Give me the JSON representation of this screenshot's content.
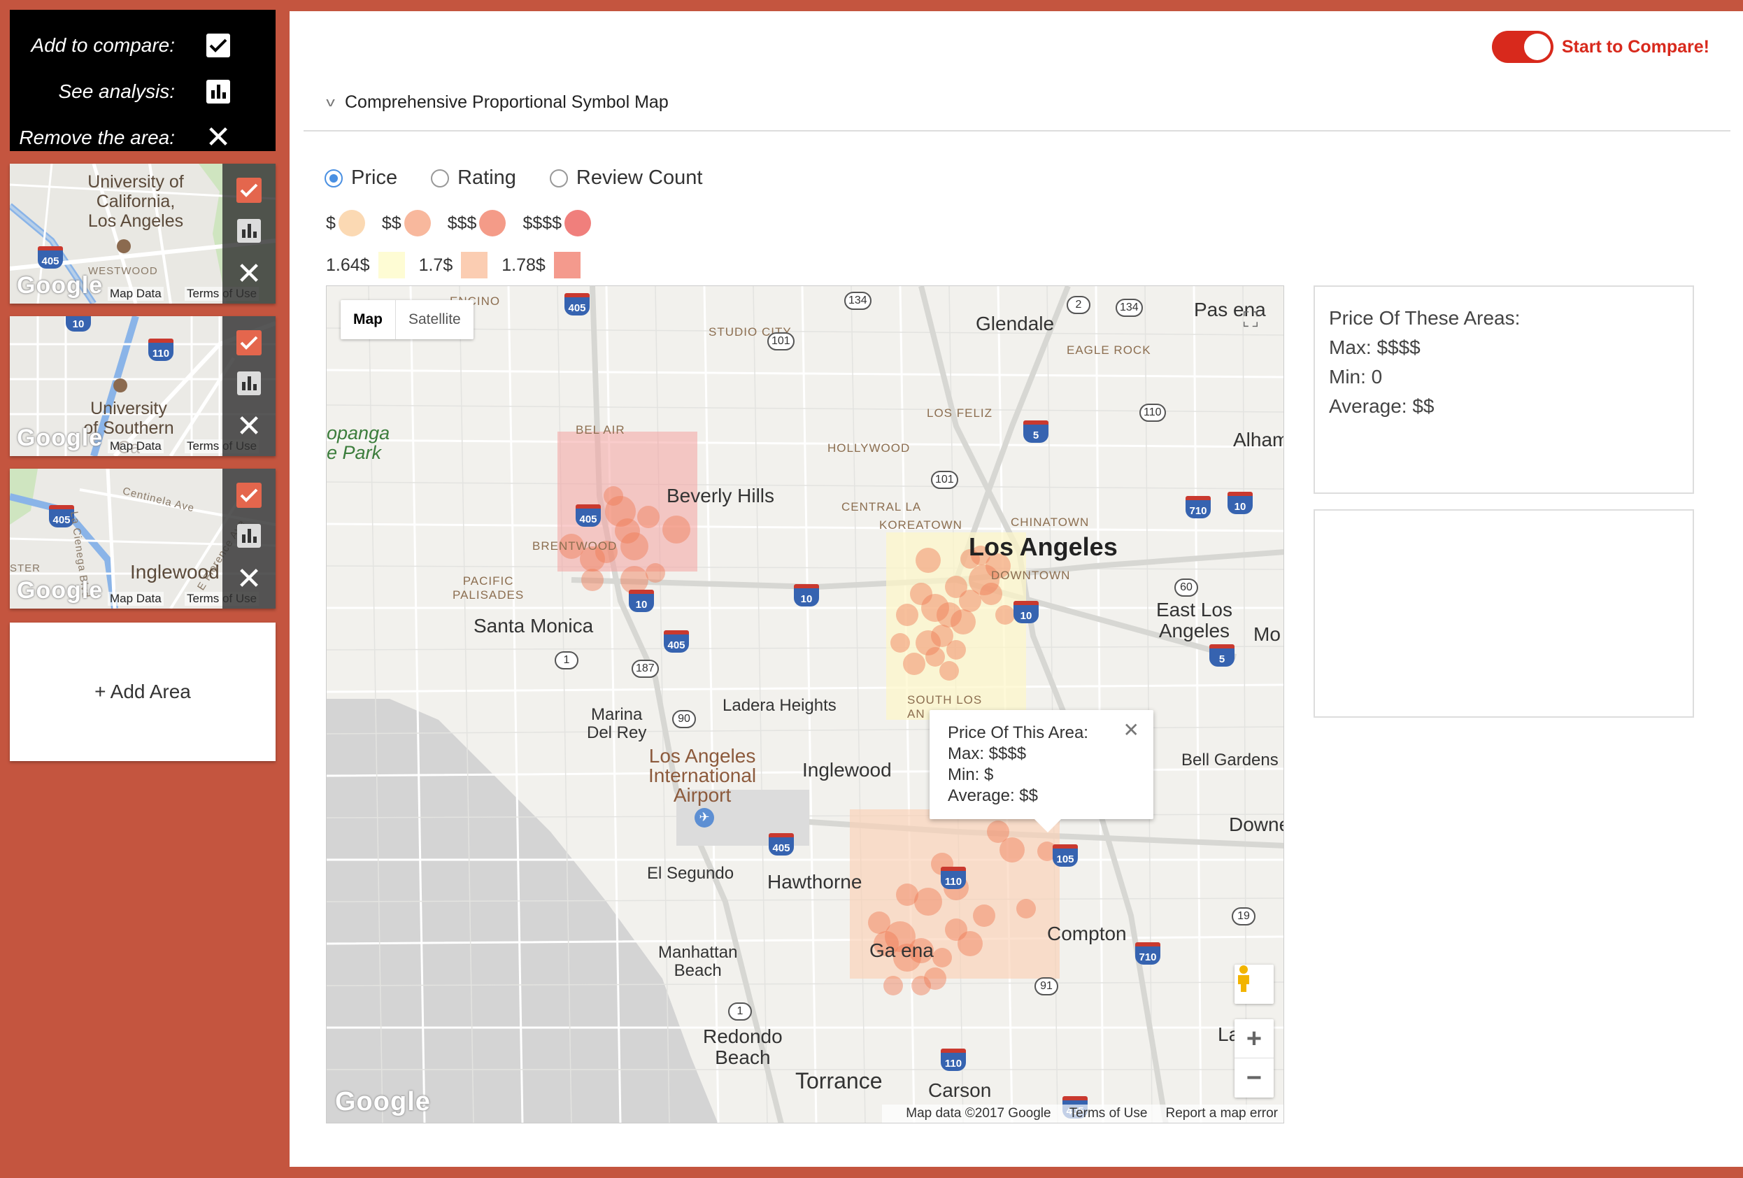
{
  "legend": {
    "compare_label": "Add to compare:",
    "analysis_label": "See analysis:",
    "remove_label": "Remove the area:"
  },
  "thumbnails": [
    {
      "place_label": "University of\nCalifornia,\nLos Angeles",
      "small_label": "WESTWOOD",
      "highway": "405",
      "google": "Google",
      "map_data": "Map Data",
      "terms": "Terms of Use"
    },
    {
      "place_label": "University\nof Southern\nCa",
      "small_label": "",
      "highway": "110",
      "highway2": "10",
      "google": "Google",
      "map_data": "Map Data",
      "terms": "Terms of Use"
    },
    {
      "place_label": "Inglewood",
      "small_label": "Centinela Ave",
      "small_label2": "La Cienega Blvd",
      "small_label3": "E Florence Ave",
      "small_label4": "STER",
      "highway": "405",
      "google": "Google",
      "map_data": "Map Data",
      "terms": "Terms of Use"
    }
  ],
  "add_area_label": "+ Add Area",
  "compare_toggle": {
    "label": "Start to Compare!",
    "on": true
  },
  "section_title": "Comprehensive Proportional Symbol Map",
  "radios": [
    {
      "label": "Price",
      "selected": true
    },
    {
      "label": "Rating",
      "selected": false
    },
    {
      "label": "Review Count",
      "selected": false
    }
  ],
  "price_legend": [
    {
      "label": "$",
      "color": "#fbd9b3"
    },
    {
      "label": "$$",
      "color": "#f8b89d"
    },
    {
      "label": "$$$",
      "color": "#f49b88"
    },
    {
      "label": "$$$$",
      "color": "#f07f7c"
    }
  ],
  "range_legend": [
    {
      "label": "1.64$",
      "color": "#fefcd4"
    },
    {
      "label": "1.7$",
      "color": "#fbcdb2"
    },
    {
      "label": "1.78$",
      "color": "#f49a8d"
    }
  ],
  "map": {
    "type_buttons": [
      "Map",
      "Satellite"
    ],
    "cities": {
      "glendale": "Glendale",
      "pasadena": "Pas  ena",
      "beverly_hills": "Beverly Hills",
      "los_angeles": "Los Angeles",
      "santa_monica": "Santa Monica",
      "east_la": "East Los\nAngeles",
      "mo": "Mo",
      "alhambra": "Alham",
      "marina": "Marina\nDel Rey",
      "ladera": "Ladera Heights",
      "lax": "Los Angeles\nInternational\nAirport",
      "inglewood": "Inglewood",
      "bell_gardens": "Bell Gardens",
      "downey": "Downe",
      "el_segundo": "El Segundo",
      "hawthorne": "Hawthorne",
      "compton": "Compton",
      "gardena": "Ga     ena",
      "manhattan": "Manhattan\nBeach",
      "redondo": "Redondo\nBeach",
      "torrance": "Torrance",
      "carson": "Carson",
      "lakewood": "La   vo"
    },
    "areas": {
      "encino": "ENCINO",
      "studio_city": "STUDIO CITY",
      "eagle_rock": "EAGLE ROCK",
      "los_feliz": "LOS FELIZ",
      "hollywood": "HOLLYWOOD",
      "bel_air": "BEL AIR",
      "central_la": "CENTRAL LA",
      "koreatown": "KOREATOWN",
      "chinatown": "CHINATOWN",
      "downtown": "DOWNTOWN",
      "brentwood": "BRENTWOOD",
      "pacific_palisades": "PACIFIC\nPALISADES",
      "south_la": "SOUTH LOS\nAN"
    },
    "park": "opanga\ne Park",
    "highways": [
      "405",
      "101",
      "134",
      "2",
      "134",
      "110",
      "5",
      "101",
      "405",
      "10",
      "10",
      "710",
      "10",
      "10",
      "405",
      "1",
      "187",
      "60",
      "5",
      "90",
      "405",
      "110",
      "105",
      "19",
      "710",
      "91",
      "1",
      "110",
      "405"
    ],
    "popup": {
      "title": "Price Of This Area:",
      "max": "Max: $$$$",
      "min": "Min: $",
      "avg": "Average: $$"
    },
    "footer": {
      "data": "Map data ©2017 Google",
      "terms": "Terms of Use",
      "report": "Report a map error"
    },
    "google": "Google"
  },
  "summary": {
    "title": "Price Of These Areas:",
    "max": "Max: $$$$",
    "min": "Min: 0",
    "avg": "Average: $$"
  }
}
